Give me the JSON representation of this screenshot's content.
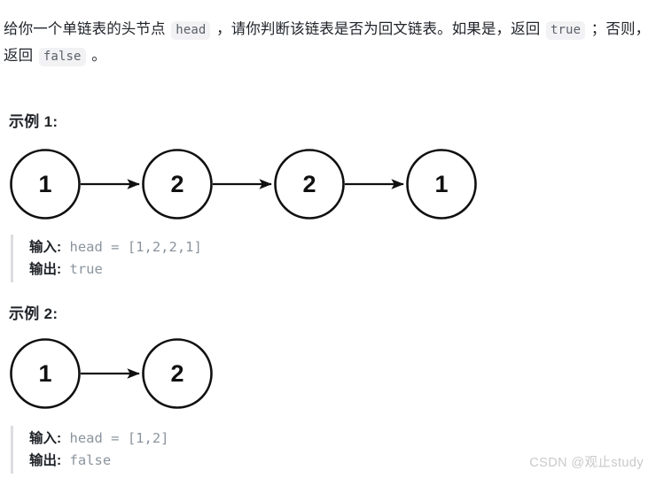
{
  "problem": {
    "intro_parts": [
      {
        "type": "text",
        "value": "给你一个单链表的头节点 "
      },
      {
        "type": "code",
        "value": "head"
      },
      {
        "type": "text",
        "value": " ，请你判断该链表是否为回文链表。如果是，返回 "
      },
      {
        "type": "code",
        "value": "true"
      },
      {
        "type": "text",
        "value": " ；否则，返回 "
      },
      {
        "type": "code",
        "value": "false"
      },
      {
        "type": "text",
        "value": " 。"
      }
    ],
    "intro_text_1": "给你一个单链表的头节点 ",
    "intro_code_head": "head",
    "intro_text_2": " ，请你判断该链表是否为回文链表。如果是，返回 ",
    "intro_code_true": "true",
    "intro_text_3": " ；否则，返回 ",
    "intro_code_false": "false",
    "intro_text_4": " 。"
  },
  "examples": [
    {
      "heading": "示例 1:",
      "nodes": [
        "1",
        "2",
        "2",
        "1"
      ],
      "input_label": "输入:",
      "input_value": " head = [1,2,2,1]",
      "output_label": "输出:",
      "output_value": " true"
    },
    {
      "heading": "示例 2:",
      "nodes": [
        "1",
        "2"
      ],
      "input_label": "输入:",
      "input_value": " head = [1,2]",
      "output_label": "输出:",
      "output_value": " false"
    }
  ],
  "watermark": "CSDN @观止study",
  "colors": {
    "text": "#1f2328",
    "code_text": "#8b949e",
    "chip_bg": "#f2f2f4",
    "chip_text": "#5b6169",
    "quote_bar": "#dcdde0",
    "node_stroke": "#101010",
    "watermark": "#c9c9c9",
    "background": "#ffffff"
  }
}
